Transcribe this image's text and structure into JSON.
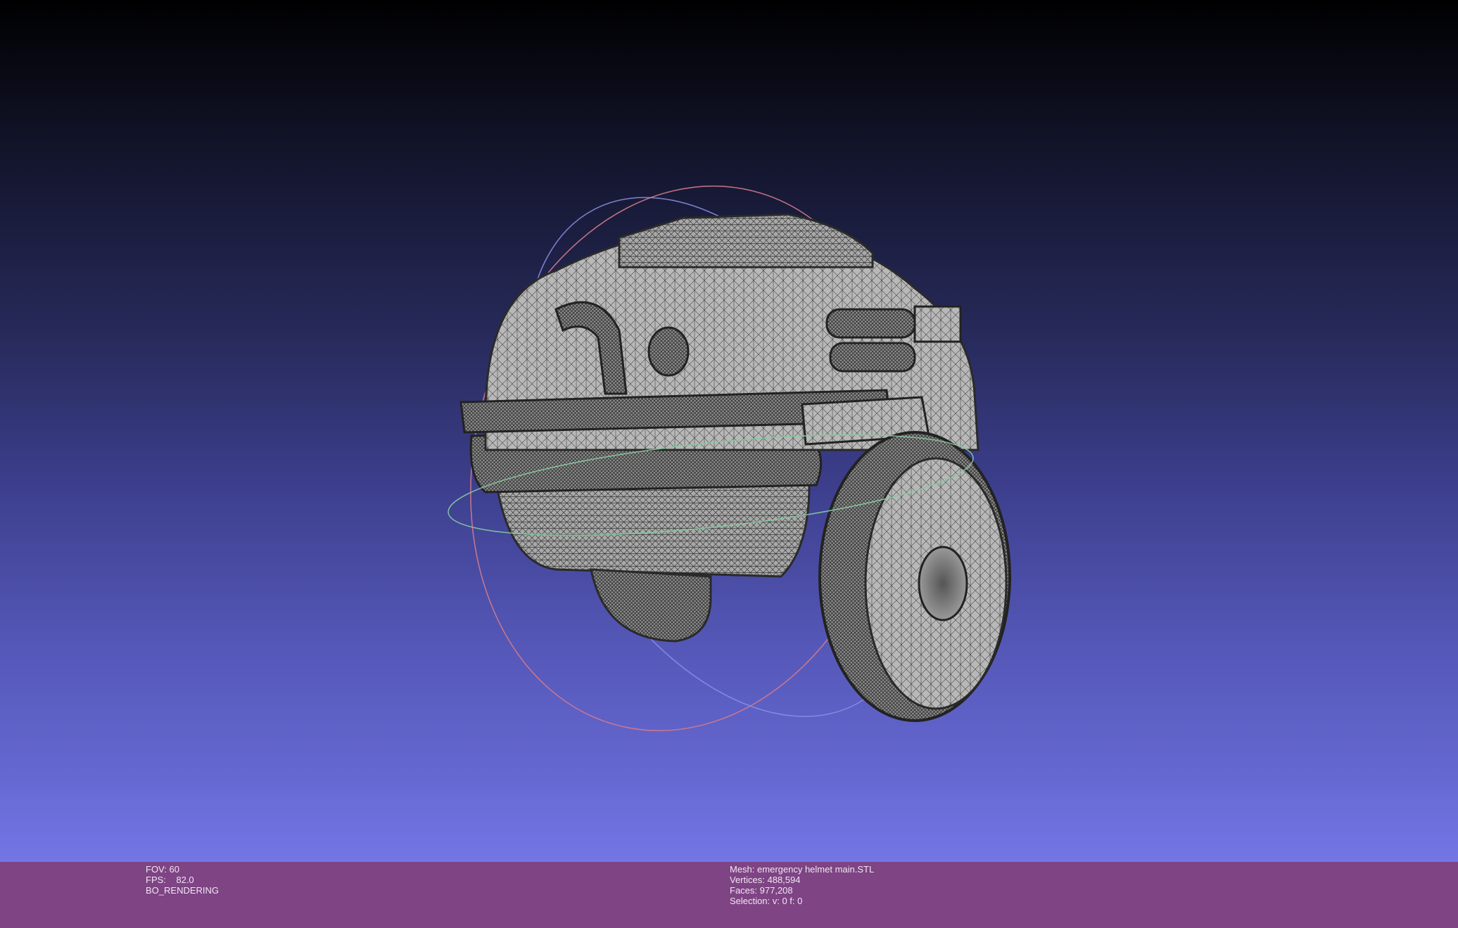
{
  "render_info": {
    "fov_label": "FOV:",
    "fov_value": "60",
    "fps_label": "FPS:",
    "fps_value": "82.0",
    "mode": "BO_RENDERING"
  },
  "mesh_info": {
    "mesh_label": "Mesh:",
    "mesh_name": "emergency helmet main.STL",
    "vertices_label": "Vertices:",
    "vertices_value": "488,594",
    "faces_label": "Faces:",
    "faces_value": "977,208",
    "selection_label": "Selection:",
    "selection_value": "v: 0 f: 0"
  },
  "colors": {
    "status_bar": "#7e4484",
    "mesh_fill": "#a9a9a9",
    "wireframe": "#3a3a3a",
    "trackball_red": "#d07a8c",
    "trackball_green": "#88c8a0",
    "trackball_blue": "#7a88e0"
  }
}
